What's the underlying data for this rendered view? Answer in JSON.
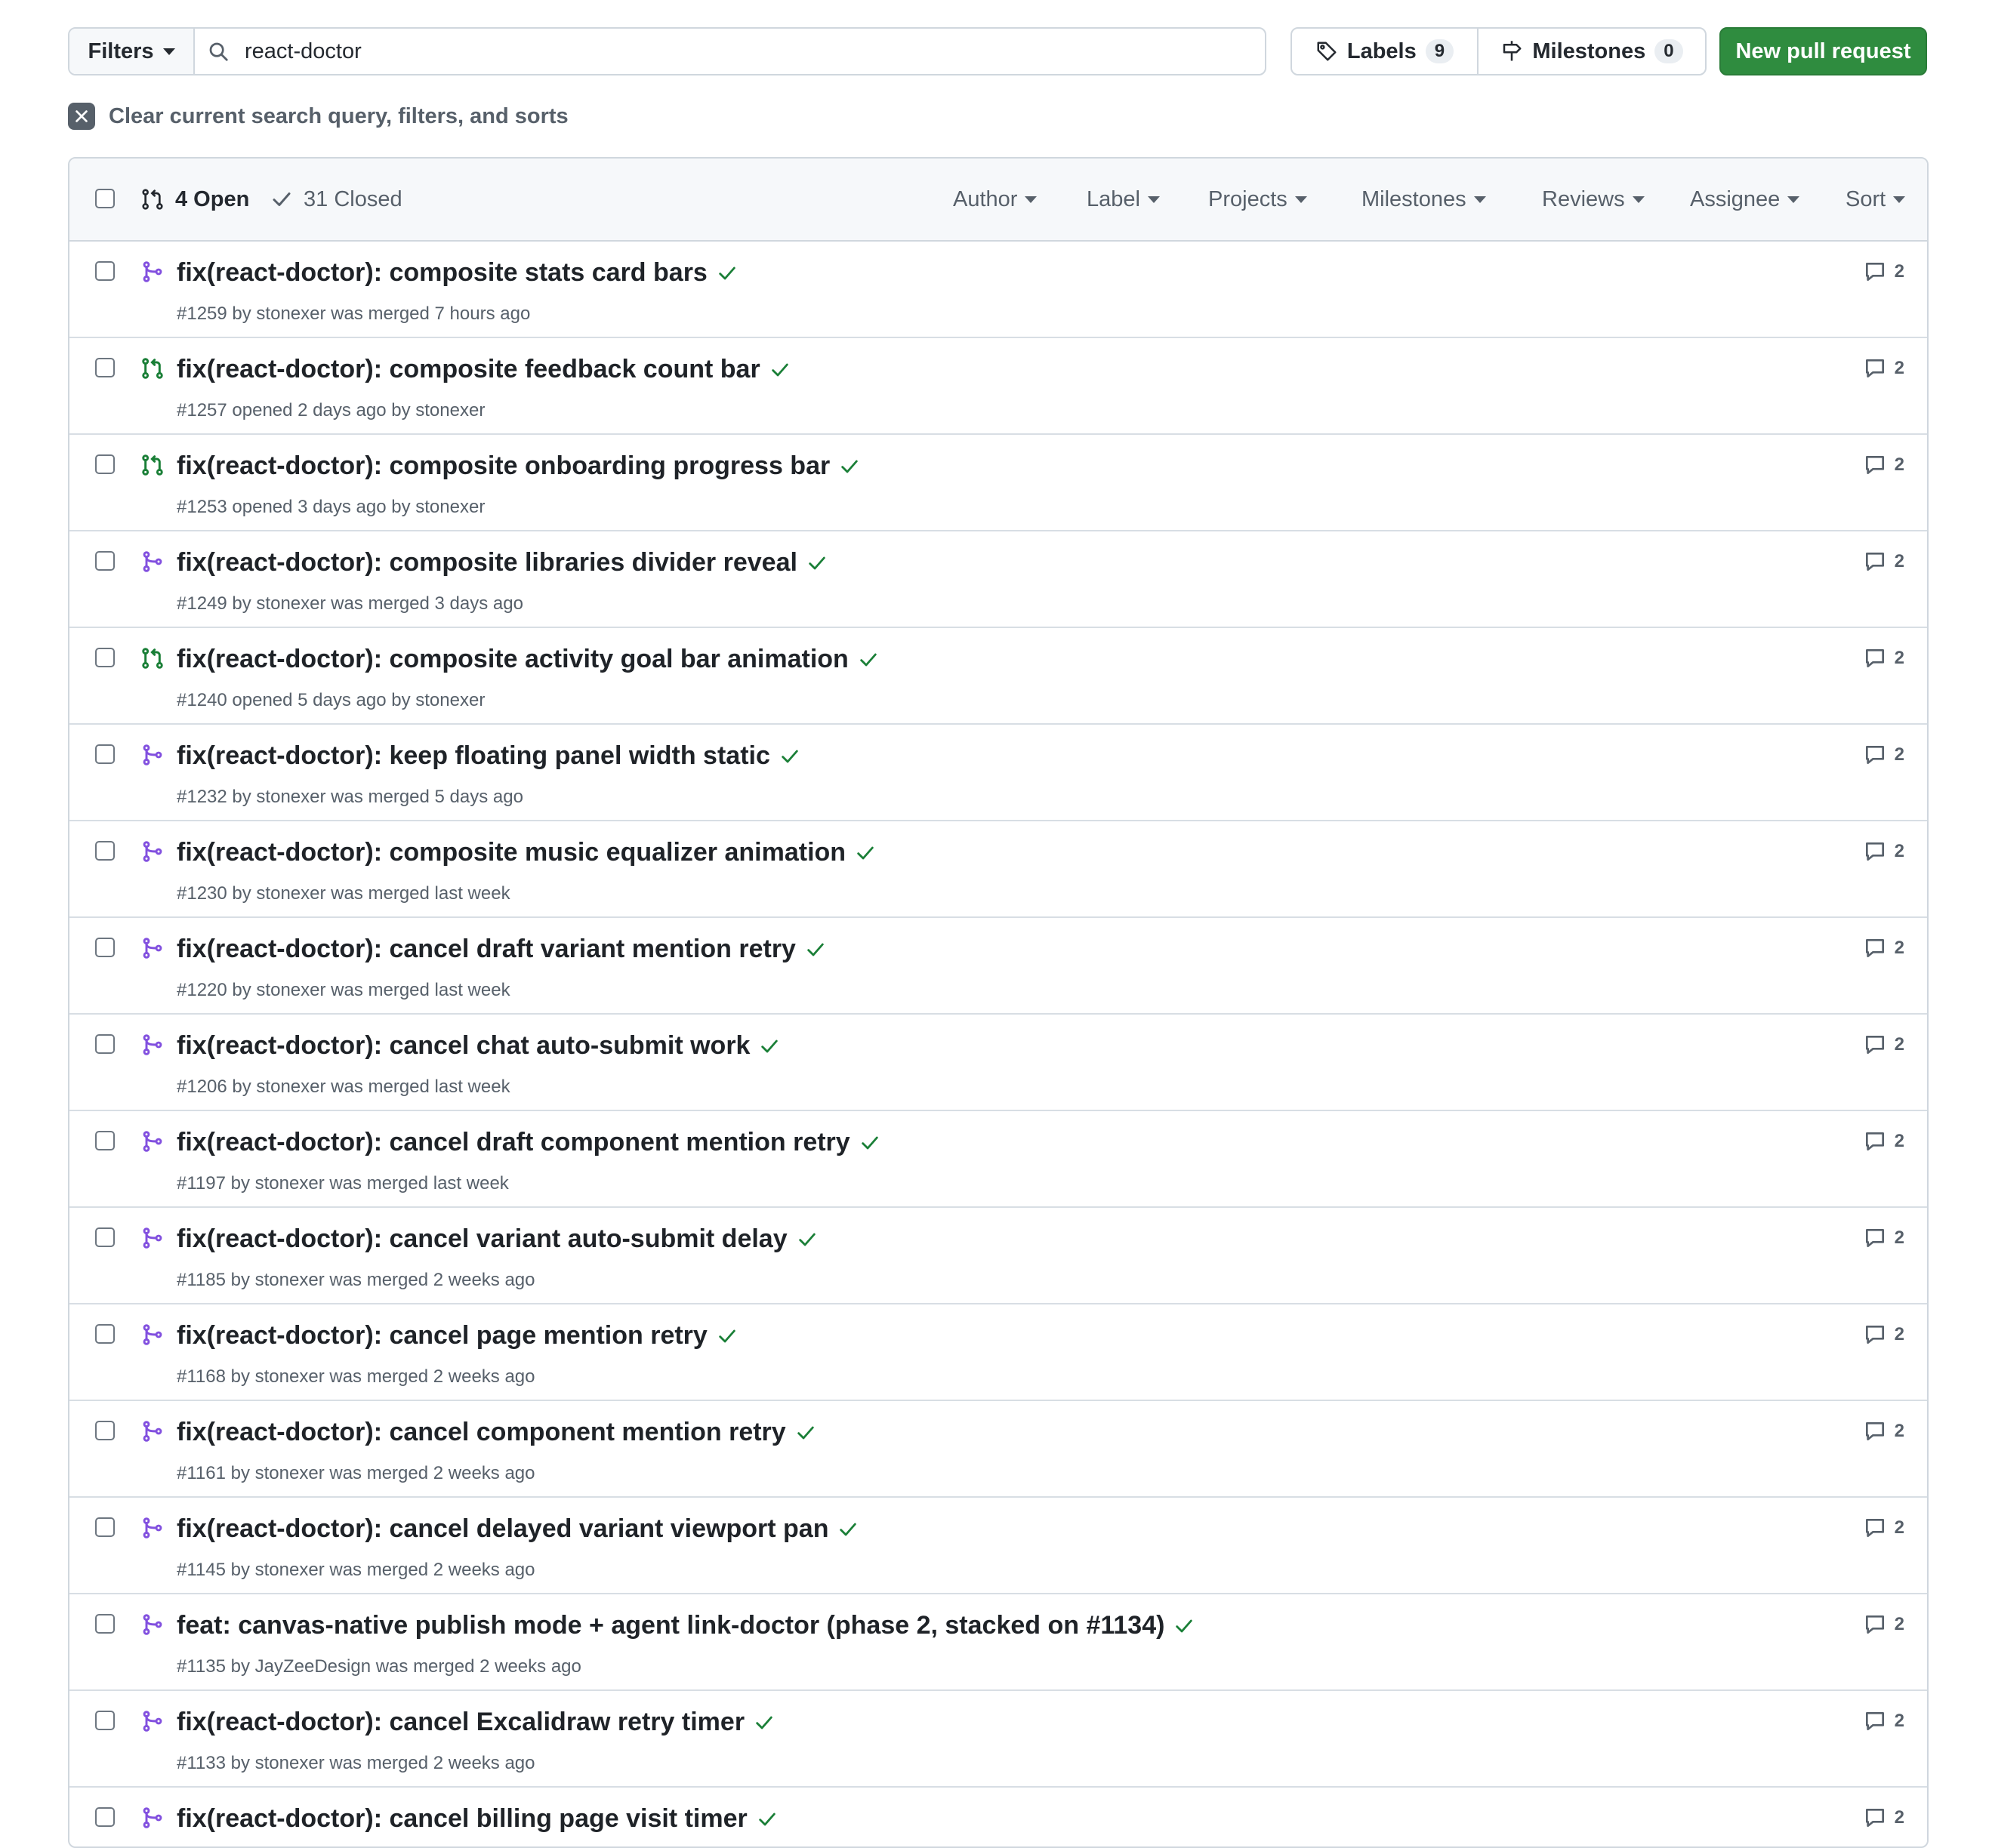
{
  "toolbar": {
    "filters_label": "Filters",
    "search_value": "react-doctor",
    "labels_label": "Labels",
    "labels_count": "9",
    "milestones_label": "Milestones",
    "milestones_count": "0",
    "new_pr_label": "New pull request"
  },
  "clear_text": "Clear current search query, filters, and sorts",
  "list_header": {
    "open_label": "4 Open",
    "closed_label": "31 Closed",
    "menus": [
      "Author",
      "Label",
      "Projects",
      "Milestones",
      "Reviews",
      "Assignee",
      "Sort"
    ]
  },
  "colors": {
    "merged": "#8250df",
    "open": "#1a7f37",
    "check": "#1a7f37",
    "primary_button": "#2f8c3f"
  },
  "pull_requests": [
    {
      "state": "merged",
      "title": "fix(react-doctor): composite stats card bars",
      "meta": "#1259 by stonexer was merged 7 hours ago",
      "comments": "2"
    },
    {
      "state": "open",
      "title": "fix(react-doctor): composite feedback count bar",
      "meta": "#1257 opened 2 days ago by stonexer",
      "comments": "2"
    },
    {
      "state": "open",
      "title": "fix(react-doctor): composite onboarding progress bar",
      "meta": "#1253 opened 3 days ago by stonexer",
      "comments": "2"
    },
    {
      "state": "merged",
      "title": "fix(react-doctor): composite libraries divider reveal",
      "meta": "#1249 by stonexer was merged 3 days ago",
      "comments": "2"
    },
    {
      "state": "open",
      "title": "fix(react-doctor): composite activity goal bar animation",
      "meta": "#1240 opened 5 days ago by stonexer",
      "comments": "2"
    },
    {
      "state": "merged",
      "title": "fix(react-doctor): keep floating panel width static",
      "meta": "#1232 by stonexer was merged 5 days ago",
      "comments": "2"
    },
    {
      "state": "merged",
      "title": "fix(react-doctor): composite music equalizer animation",
      "meta": "#1230 by stonexer was merged last week",
      "comments": "2"
    },
    {
      "state": "merged",
      "title": "fix(react-doctor): cancel draft variant mention retry",
      "meta": "#1220 by stonexer was merged last week",
      "comments": "2"
    },
    {
      "state": "merged",
      "title": "fix(react-doctor): cancel chat auto-submit work",
      "meta": "#1206 by stonexer was merged last week",
      "comments": "2"
    },
    {
      "state": "merged",
      "title": "fix(react-doctor): cancel draft component mention retry",
      "meta": "#1197 by stonexer was merged last week",
      "comments": "2"
    },
    {
      "state": "merged",
      "title": "fix(react-doctor): cancel variant auto-submit delay",
      "meta": "#1185 by stonexer was merged 2 weeks ago",
      "comments": "2"
    },
    {
      "state": "merged",
      "title": "fix(react-doctor): cancel page mention retry",
      "meta": "#1168 by stonexer was merged 2 weeks ago",
      "comments": "2"
    },
    {
      "state": "merged",
      "title": "fix(react-doctor): cancel component mention retry",
      "meta": "#1161 by stonexer was merged 2 weeks ago",
      "comments": "2"
    },
    {
      "state": "merged",
      "title": "fix(react-doctor): cancel delayed variant viewport pan",
      "meta": "#1145 by stonexer was merged 2 weeks ago",
      "comments": "2"
    },
    {
      "state": "merged",
      "title": "feat: canvas-native publish mode + agent link-doctor (phase 2, stacked on #1134)",
      "meta": "#1135 by JayZeeDesign was merged 2 weeks ago",
      "comments": "2"
    },
    {
      "state": "merged",
      "title": "fix(react-doctor): cancel Excalidraw retry timer",
      "meta": "#1133 by stonexer was merged 2 weeks ago",
      "comments": "2"
    },
    {
      "state": "merged",
      "title": "fix(react-doctor): cancel billing page visit timer",
      "meta": "",
      "comments": "2"
    }
  ]
}
